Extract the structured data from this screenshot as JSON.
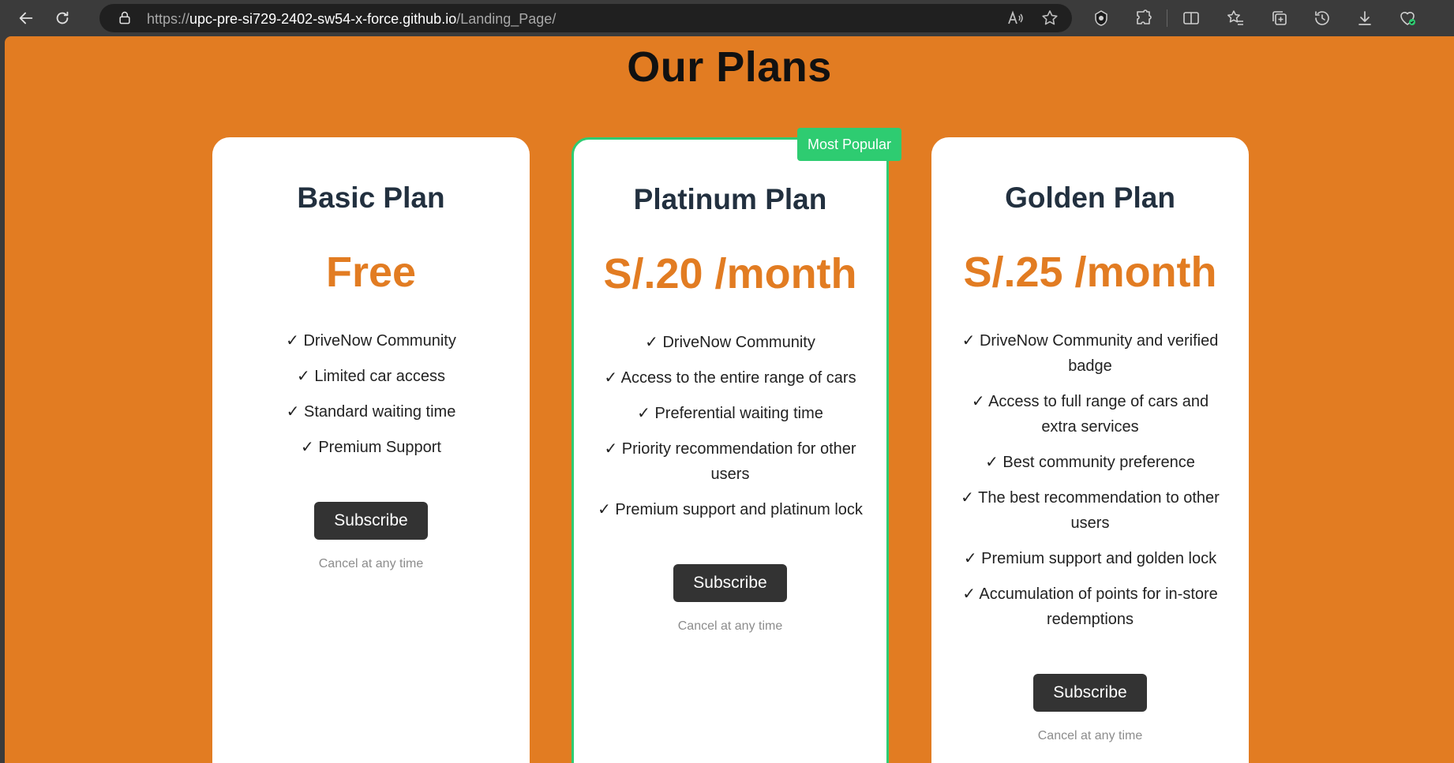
{
  "browser": {
    "url_scheme": "https://",
    "url_host": "upc-pre-si729-2402-sw54-x-force.github.io",
    "url_path": "/Landing_Page/"
  },
  "page": {
    "title": "Our Plans",
    "badge": "Most Popular"
  },
  "plans": [
    {
      "name": "Basic Plan",
      "price": "Free",
      "features": [
        "✓ DriveNow Community",
        "✓ Limited car access",
        "✓ Standard waiting time",
        "✓ Premium Support"
      ],
      "button": "Subscribe",
      "note": "Cancel at any time"
    },
    {
      "name": "Platinum Plan",
      "price": "S/.20 /month",
      "features": [
        "✓ DriveNow Community",
        "✓ Access to the entire range of cars",
        "✓ Preferential waiting time",
        "✓ Priority recommendation for other users",
        "✓ Premium support and platinum lock"
      ],
      "button": "Subscribe",
      "note": "Cancel at any time"
    },
    {
      "name": "Golden Plan",
      "price": "S/.25 /month",
      "features": [
        "✓ DriveNow Community and verified badge",
        "✓ Access to full range of cars and extra services",
        "✓ Best community preference",
        "✓ The best recommendation to other users",
        "✓ Premium support and golden lock",
        "✓ Accumulation of points for in-store redemptions"
      ],
      "button": "Subscribe",
      "note": "Cancel at any time"
    }
  ],
  "colors": {
    "page_background": "#e27c22",
    "price": "#e27c22",
    "popular_badge": "#2ecc71",
    "button": "#333333",
    "title_text": "#22303f"
  }
}
